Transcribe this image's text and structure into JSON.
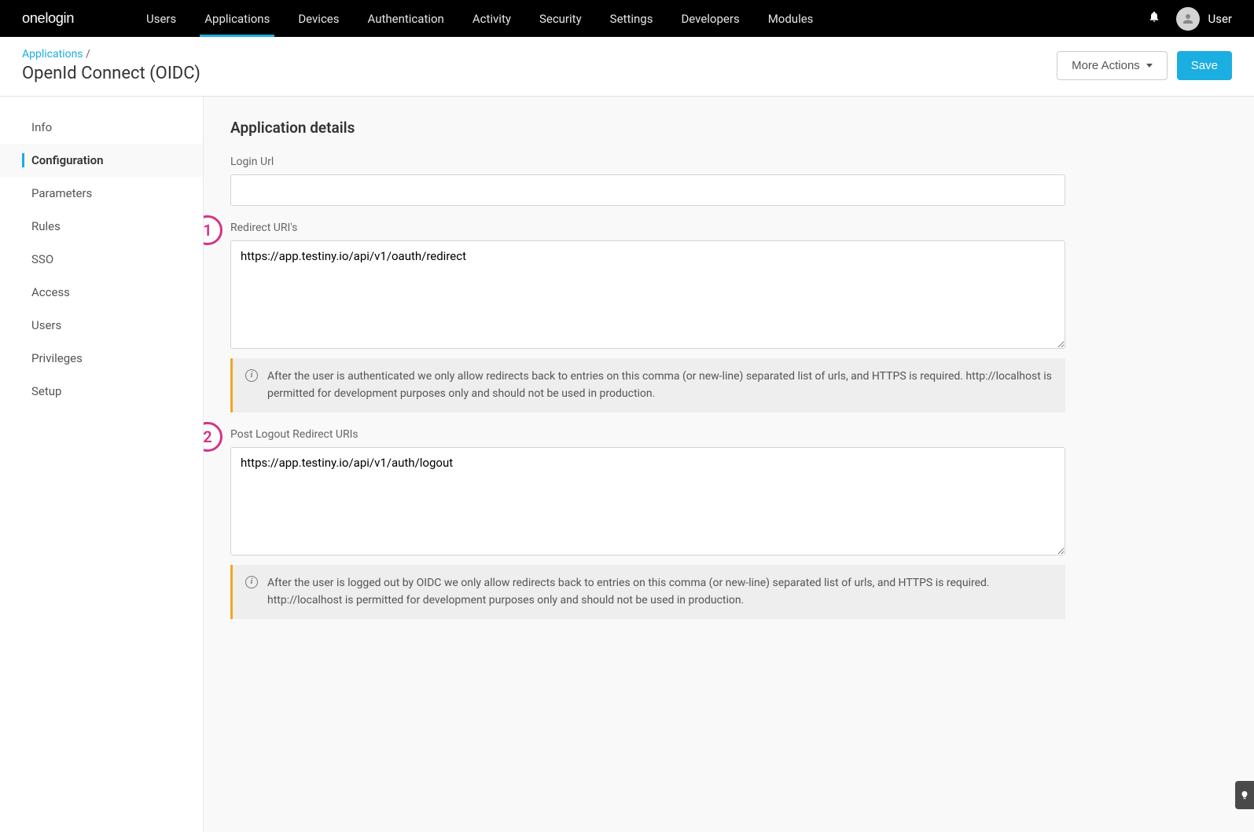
{
  "brand": "onelogin",
  "nav": {
    "items": [
      {
        "label": "Users"
      },
      {
        "label": "Applications"
      },
      {
        "label": "Devices"
      },
      {
        "label": "Authentication"
      },
      {
        "label": "Activity"
      },
      {
        "label": "Security"
      },
      {
        "label": "Settings"
      },
      {
        "label": "Developers"
      },
      {
        "label": "Modules"
      }
    ],
    "user_label": "User"
  },
  "header": {
    "breadcrumb_text": "Applications",
    "breadcrumb_sep": "/",
    "page_title": "OpenId Connect (OIDC)",
    "more_actions": "More Actions",
    "save": "Save"
  },
  "sidebar": {
    "items": [
      {
        "label": "Info"
      },
      {
        "label": "Configuration"
      },
      {
        "label": "Parameters"
      },
      {
        "label": "Rules"
      },
      {
        "label": "SSO"
      },
      {
        "label": "Access"
      },
      {
        "label": "Users"
      },
      {
        "label": "Privileges"
      },
      {
        "label": "Setup"
      }
    ]
  },
  "form": {
    "section_title": "Application details",
    "login_url": {
      "label": "Login Url",
      "value": ""
    },
    "redirect_uris": {
      "callout": "1",
      "label": "Redirect URI's",
      "value": "https://app.testiny.io/api/v1/oauth/redirect",
      "info": "After the user is authenticated we only allow redirects back to entries on this comma (or new-line) separated list of urls, and HTTPS is required. http://localhost is permitted for development purposes only and should not be used in production."
    },
    "post_logout_uris": {
      "callout": "2",
      "label": "Post Logout Redirect URIs",
      "value": "https://app.testiny.io/api/v1/auth/logout",
      "info": "After the user is logged out by OIDC we only allow redirects back to entries on this comma (or new-line) separated list of urls, and HTTPS is required. http://localhost is permitted for development purposes only and should not be used in production."
    }
  }
}
